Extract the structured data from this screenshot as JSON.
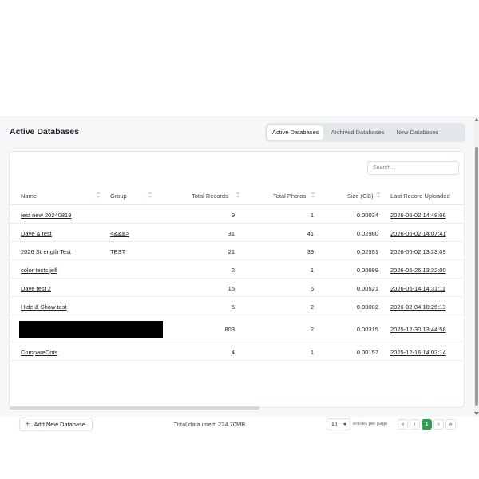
{
  "page_title": "Active Databases",
  "tabs": [
    {
      "label": "Active Databases",
      "active": true
    },
    {
      "label": "Archived Databases",
      "active": false
    },
    {
      "label": "New Databases",
      "active": false
    }
  ],
  "search": {
    "placeholder": "Search..."
  },
  "table": {
    "columns": [
      "Name",
      "Group",
      "Total Records",
      "Total Photos",
      "Size (GB)",
      "Last Record Uploaded"
    ],
    "rows": [
      {
        "name": "test new 20240819",
        "group": "",
        "records": "9",
        "photos": "1",
        "size": "0.00034",
        "last": "2026-06-02 14:48:06"
      },
      {
        "name": "Dave & test",
        "group": "<&&&>",
        "records": "31",
        "photos": "41",
        "size": "0.02980",
        "last": "2026-06-02 14:07:41"
      },
      {
        "name": "2026 Strength Test",
        "group": "TEST",
        "records": "21",
        "photos": "39",
        "size": "0.02551",
        "last": "2026-06-02 13:23:09"
      },
      {
        "name": "color tests jeff",
        "group": "",
        "records": "2",
        "photos": "1",
        "size": "0.00099",
        "last": "2026-05-26 13:32:00"
      },
      {
        "name": "Dave test 2",
        "group": "",
        "records": "15",
        "photos": "6",
        "size": "0.00521",
        "last": "2026-05-14 14:31:11"
      },
      {
        "name": "Hide & Show test",
        "group": "",
        "records": "5",
        "photos": "2",
        "size": "0.00002",
        "last": "2026-02-04 10:25:13"
      },
      {
        "name": "",
        "group": "",
        "records": "803",
        "photos": "2",
        "size": "0.00315",
        "last": "2025-12-30 13:44:58",
        "redacted": true
      },
      {
        "name": "CompareDots",
        "group": "",
        "records": "4",
        "photos": "1",
        "size": "0.00157",
        "last": "2025-12-16 14:03:14"
      }
    ]
  },
  "footer": {
    "add_button": "Add New Database",
    "total_used": "Total data used: 224.70MB",
    "per_page_value": "10",
    "per_page_label": "entries per page",
    "pagination": [
      "«",
      "‹",
      "1",
      "›",
      "»"
    ],
    "current_page": "1"
  },
  "colors": {
    "accent": "#2e9e4f",
    "redaction": "#000000"
  }
}
